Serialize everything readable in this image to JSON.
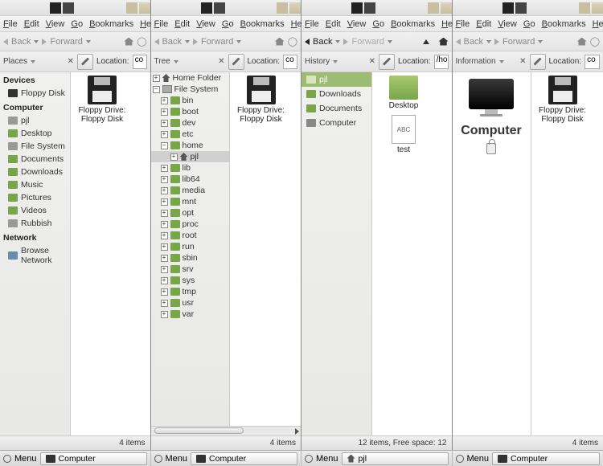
{
  "menus": {
    "file": "File",
    "edit": "Edit",
    "view": "View",
    "go": "Go",
    "bookmarks": "Bookmarks",
    "help": "Help"
  },
  "nav": {
    "back": "Back",
    "forward": "Forward"
  },
  "loc": {
    "label": "Location:"
  },
  "pane1": {
    "side_mode": "Places",
    "loc_value": "co",
    "devices_head": "Devices",
    "devices": [
      {
        "label": "Floppy Disk"
      }
    ],
    "computer_head": "Computer",
    "places": [
      "pjl",
      "Desktop",
      "File System",
      "Documents",
      "Downloads",
      "Music",
      "Pictures",
      "Videos",
      "Rubbish"
    ],
    "network_head": "Network",
    "network": [
      "Browse Network"
    ],
    "icons": [
      {
        "label": "Floppy Drive: Floppy Disk"
      }
    ],
    "status": "4 items",
    "task": "Computer"
  },
  "pane2": {
    "side_mode": "Tree",
    "loc_value": "co",
    "root1": "Home Folder",
    "root2": "File System",
    "dirs": [
      "bin",
      "boot",
      "dev",
      "etc",
      "home",
      "lib",
      "lib64",
      "media",
      "mnt",
      "opt",
      "proc",
      "root",
      "run",
      "sbin",
      "srv",
      "sys",
      "tmp",
      "usr",
      "var"
    ],
    "home_user": "pjl",
    "icons": [
      {
        "label": "Floppy Drive: Floppy Disk"
      }
    ],
    "status": "4 items",
    "task": "Computer"
  },
  "pane3": {
    "side_mode": "History",
    "loc_value": "/ho",
    "history": [
      "pjl",
      "Downloads",
      "Documents",
      "Computer"
    ],
    "icons": [
      {
        "type": "desk",
        "label": "Desktop"
      },
      {
        "type": "txt",
        "label": "test",
        "badge": "ABC"
      }
    ],
    "status": "12 items, Free space: 12",
    "task": "pjl"
  },
  "pane4": {
    "side_mode": "Information",
    "loc_value": "co",
    "info_title": "Computer",
    "icons": [
      {
        "label": "Floppy Drive: Floppy Disk"
      }
    ],
    "status": "4 items",
    "task": "Computer"
  },
  "taskbar_menu": "Menu"
}
